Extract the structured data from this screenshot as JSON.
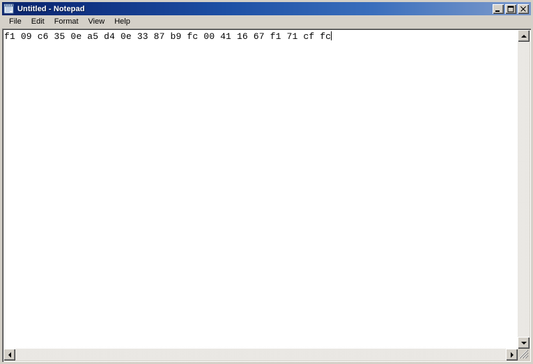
{
  "window": {
    "title": "Untitled - Notepad",
    "icon": "notepad-icon",
    "controls": {
      "minimize_label": "_",
      "maximize_label": "□",
      "close_label": "✕"
    }
  },
  "menubar": {
    "items": [
      {
        "label": "File"
      },
      {
        "label": "Edit"
      },
      {
        "label": "Format"
      },
      {
        "label": "View"
      },
      {
        "label": "Help"
      }
    ]
  },
  "editor": {
    "content": "f1 09 c6 35 0e a5 d4 0e 33 87 b9 fc 00 41 16 67 f1 71 cf fc",
    "caret_visible": true
  },
  "scrollbars": {
    "vertical": {
      "up_arrow": "scroll-up-arrow",
      "down_arrow": "scroll-down-arrow"
    },
    "horizontal": {
      "left_arrow": "scroll-left-arrow",
      "right_arrow": "scroll-right-arrow"
    },
    "resize_grip": "resize-grip"
  },
  "colors": {
    "title_gradient_start": "#0a246a",
    "title_gradient_end": "#7b99cd",
    "face": "#d4d0c8",
    "text": "#000000",
    "editor_background": "#ffffff"
  }
}
